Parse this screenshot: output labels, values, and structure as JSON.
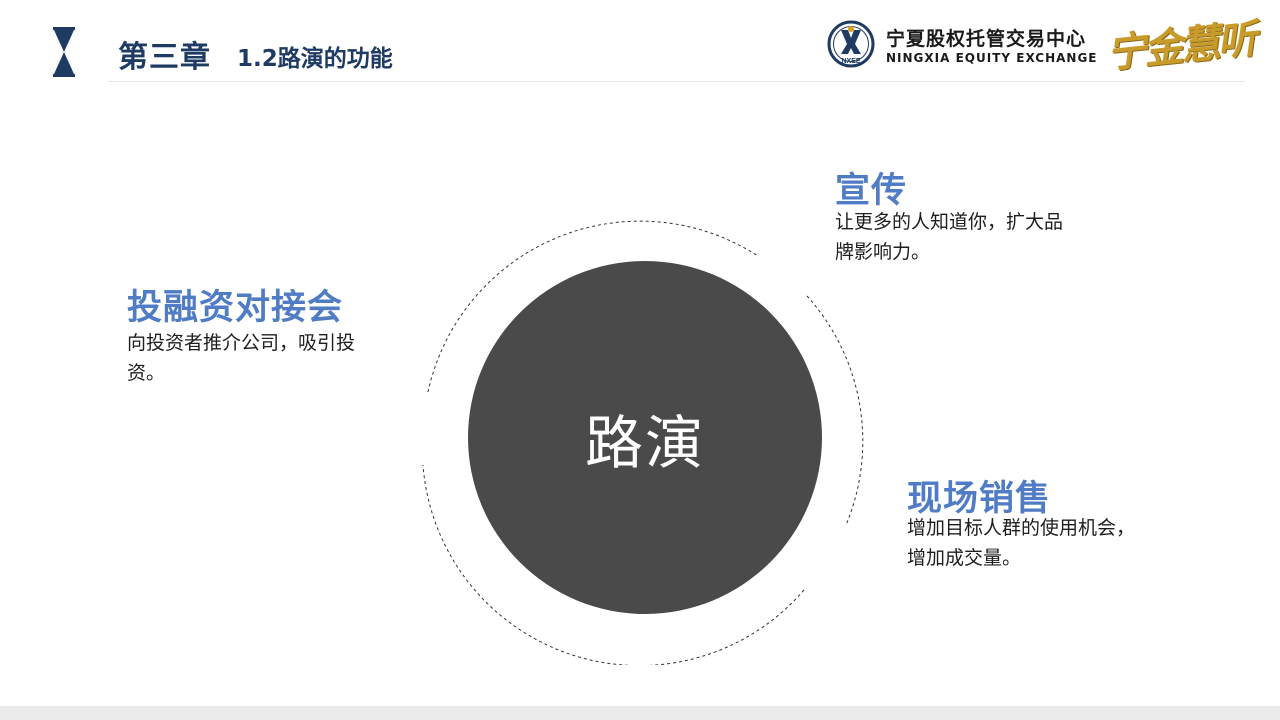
{
  "header": {
    "chapter": "第三章",
    "section": "1.2路演的功能",
    "colors": {
      "title": "#1f3b64",
      "accent": "#4f7cc4"
    }
  },
  "logo": {
    "emblem_text": "NXEE",
    "name_cn": "宁夏股权托管交易中心",
    "name_en": "NINGXIA EQUITY EXCHANGE",
    "seal_text": "宁金慧听"
  },
  "diagram": {
    "center_label": "路演",
    "items": [
      {
        "title": "投融资对接会",
        "lines": [
          "向投资者推介公司，吸引投",
          "资。"
        ]
      },
      {
        "title": "宣传",
        "lines": [
          "让更多的人知道你，扩大品",
          "牌影响力。"
        ]
      },
      {
        "title": "现场销售",
        "lines": [
          "增加目标人群的使用机会，",
          "增加成交量。"
        ]
      }
    ]
  }
}
